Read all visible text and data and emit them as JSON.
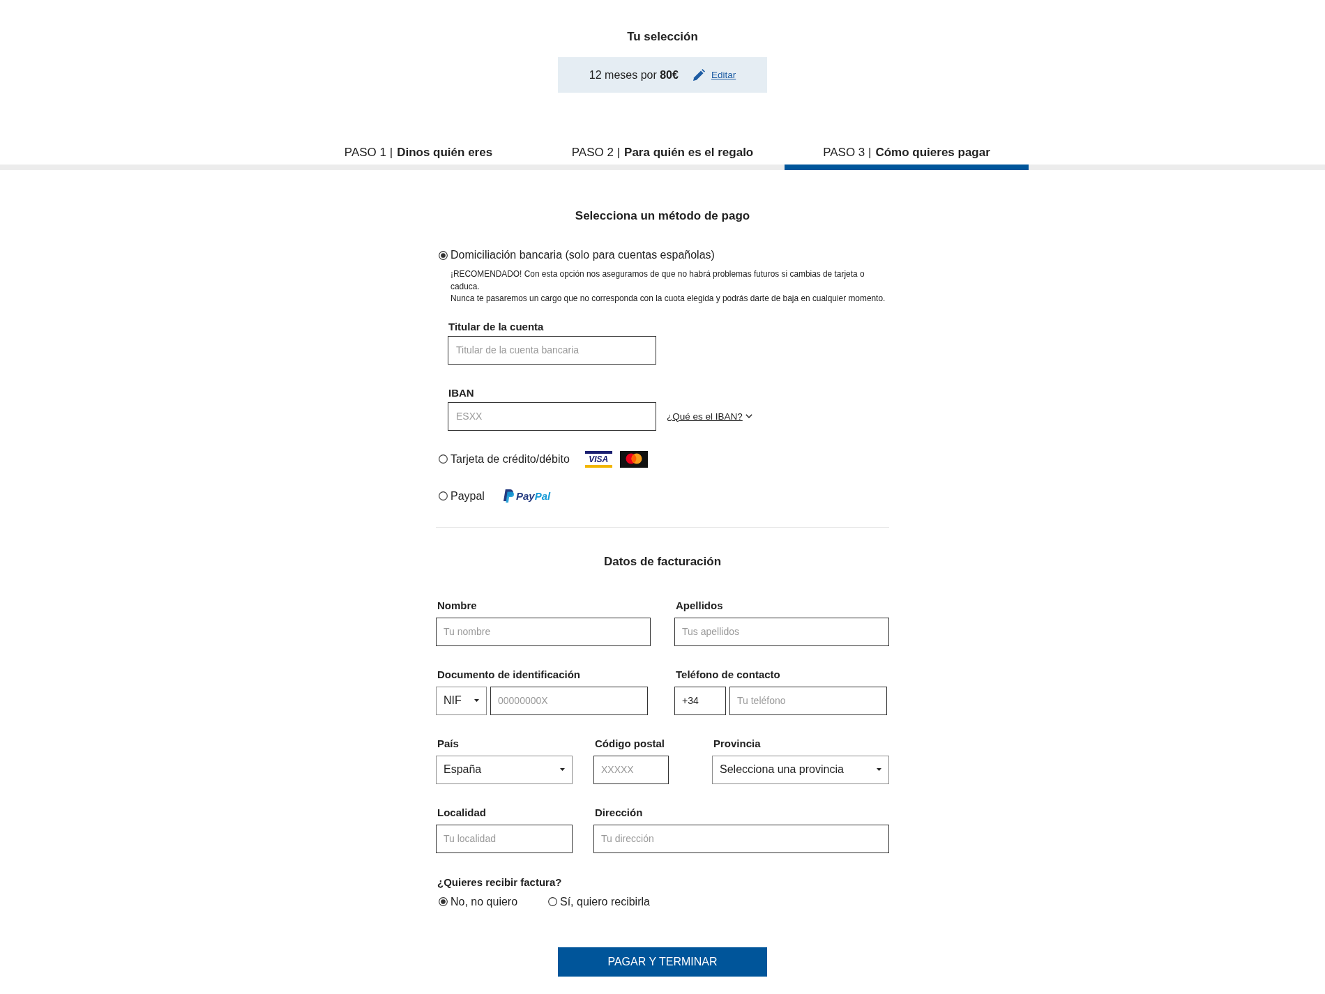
{
  "selection": {
    "title": "Tu selección",
    "summary": "12 meses por **80€**",
    "edit_link": "Editar"
  },
  "steps": [
    {
      "number": "PASO 1 |",
      "label": "Dinos quién eres",
      "selected": false
    },
    {
      "number": "PASO 2 |",
      "label": "Para quién es el regalo",
      "selected": false
    },
    {
      "number": "PASO 3 |",
      "label": "Cómo quieres pagar",
      "selected": true
    }
  ],
  "payment": {
    "title": "Selecciona un método de pago",
    "methods": [
      {
        "kind": "bank",
        "label": "Domiciliación bancaria (solo para cuentas españolas)",
        "selected": true,
        "notes": [
          "¡RECOMENDADO! Con esta opción nos aseguramos de que no habrá problemas futuros si cambias de tarjeta o caduca.",
          "Nunca te pasaremos un cargo que no corresponda con la cuota elegida y podrás darte de baja en cualquier momento."
        ],
        "fields": [
          {
            "label": "Titular de la cuenta",
            "placeholder": "Titular de la cuenta bancaria"
          },
          {
            "label": "IBAN",
            "placeholder": "ESXX",
            "help_link": "¿Qué es el IBAN?"
          }
        ]
      },
      {
        "kind": "card",
        "label": "Tarjeta de crédito/débito",
        "selected": false,
        "logo_text": "VISA"
      },
      {
        "kind": "paypal",
        "label": "Paypal",
        "selected": false,
        "wordmark": [
          "Pay",
          "Pal"
        ]
      }
    ]
  },
  "billing": {
    "title": "Datos de facturación",
    "rows": [
      {
        "fields": [
          {
            "kind": "text",
            "label": "Nombre",
            "placeholder": "Tu nombre"
          },
          {
            "kind": "text",
            "label": "Apellidos",
            "placeholder": "Tus apellidos"
          }
        ]
      },
      {
        "fields": [
          {
            "kind": "select_text",
            "label": "Documento de identificación",
            "select_value": "NIF",
            "placeholder": "00000000X"
          },
          {
            "kind": "prefix_text",
            "label": "Teléfono de contacto",
            "prefix": "+34",
            "placeholder": "Tu teléfono"
          }
        ]
      },
      {
        "fields": [
          {
            "kind": "select",
            "label": "País",
            "value": "España"
          },
          {
            "kind": "text",
            "label": "Código postal",
            "placeholder": "XXXXX"
          },
          {
            "kind": "select",
            "label": "Provincia",
            "value": "Selecciona una provincia"
          }
        ]
      },
      {
        "fields": [
          {
            "kind": "text",
            "label": "Localidad",
            "placeholder": "Tu localidad"
          },
          {
            "kind": "text",
            "label": "Dirección",
            "placeholder": "Tu dirección"
          }
        ]
      }
    ]
  },
  "invoice": {
    "question": "¿Quieres recibir factura?",
    "options": [
      {
        "label": "No, no quiero",
        "selected": true
      },
      {
        "label": "Sí, quiero recibirla",
        "selected": false
      }
    ]
  },
  "submit_button": "PAGAR Y TERMINAR"
}
